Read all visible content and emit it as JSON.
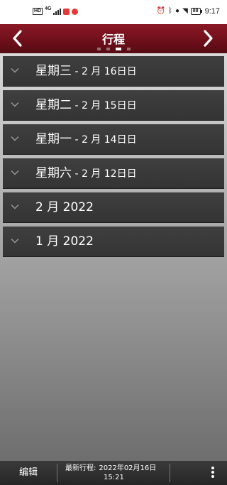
{
  "status_bar": {
    "hd": "HD",
    "network": "4G",
    "battery": "88",
    "time": "9:17"
  },
  "header": {
    "title": "行程",
    "page_count": 4,
    "active_page": 2,
    "colors": {
      "background": "#6d0f1a",
      "accent": "#ffffff"
    }
  },
  "groups": [
    {
      "title": "星期三",
      "subtitle": " - 2 月 16日日"
    },
    {
      "title": "星期二",
      "subtitle": " - 2 月 15日日"
    },
    {
      "title": "星期一",
      "subtitle": " - 2 月 14日日"
    },
    {
      "title": "星期六",
      "subtitle": " - 2 月 12日日"
    },
    {
      "title": "2 月 2022",
      "subtitle": ""
    },
    {
      "title": "1 月 2022",
      "subtitle": ""
    }
  ],
  "icons": {
    "back": "chevron-left-icon",
    "forward": "chevron-right-icon",
    "expand": "chevron-down-icon",
    "menu": "more-vertical-icon"
  },
  "bottom_bar": {
    "edit_label": "编辑",
    "last_sync_label": "最新行程:",
    "last_sync_date": "2022年02月16日",
    "last_sync_time": "15:21"
  }
}
